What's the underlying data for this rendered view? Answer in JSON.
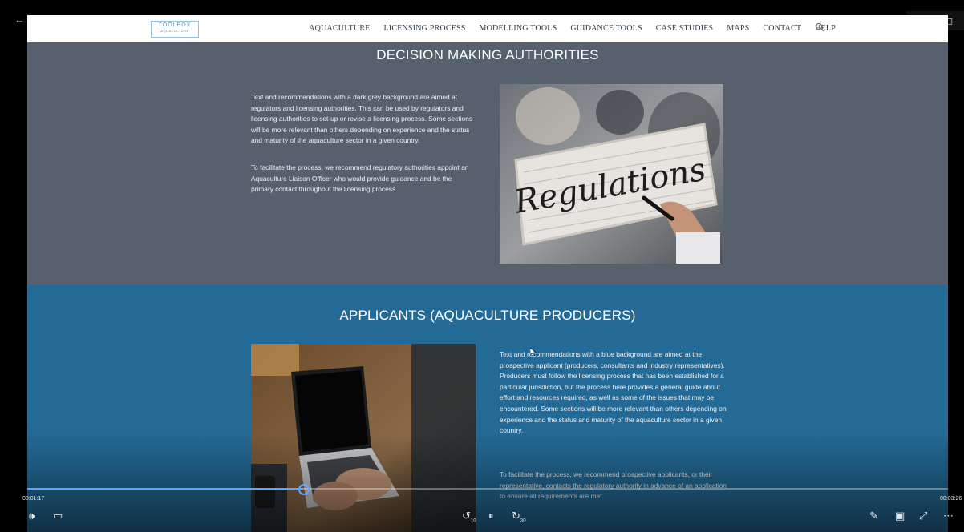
{
  "window": {
    "back_icon": "←",
    "minimize_icon": "–",
    "restore_icon": "◻"
  },
  "nav": {
    "logo": {
      "title": "TOOLBOX",
      "subtitle": "AQUACULTURE"
    },
    "items": [
      "AQUACULTURE",
      "LICENSING PROCESS",
      "MODELLING TOOLS",
      "GUIDANCE TOOLS",
      "CASE STUDIES",
      "MAPS",
      "CONTACT",
      "HELP"
    ],
    "search_icon": "search-icon"
  },
  "decision": {
    "title": "DECISION MAKING AUTHORITIES",
    "para1": "Text and recommendations with a dark grey background are aimed at regulators and licensing authorities. This can be used by regulators and licensing authorities to set-up or revise a licensing process. Some sections will be more relevant than others depending on experience and the status and maturity of the aquaculture sector in a given country.",
    "para2": "To facilitate the process, we recommend regulatory authorities appoint an Aquaculture Liaison Officer who would provide guidance and be the primary contact throughout the licensing process.",
    "image_text": "Regulations"
  },
  "applicants": {
    "title": "APPLICANTS (AQUACULTURE PRODUCERS)",
    "para1": "Text and recommendations with a blue background are aimed at the prospective applicant (producers, consultants and industry representatives). Producers must follow the licensing process that has been established for a particular jurisdiction, but the process here provides a general guide about effort and resources required, as well as some of the issues that may be encountered. Some sections will be more relevant than others depending on experience and the status and maturity of the aquaculture sector in a given country.",
    "para2": "To facilitate the process, we recommend prospective applicants, or their representative, contacts the regulatory authority in advance of an application to ensure all requirements are met."
  },
  "player": {
    "elapsed": "00:01:17",
    "total": "00:03:26",
    "progress": 0.3,
    "accent": "#5ea6ff",
    "icons": {
      "volume": "🕪",
      "captions": "▭",
      "rewind": "↺",
      "rewind_seconds": "10",
      "pause": "⏸",
      "forward": "↻",
      "forward_seconds": "30",
      "pen": "✎",
      "miniplayer": "▣",
      "fullscreen": "⤢",
      "more": "⋯"
    }
  },
  "colors": {
    "grey_section": "#56616d",
    "blue_section": "#236a96",
    "nav_bg": "#ffffff"
  }
}
